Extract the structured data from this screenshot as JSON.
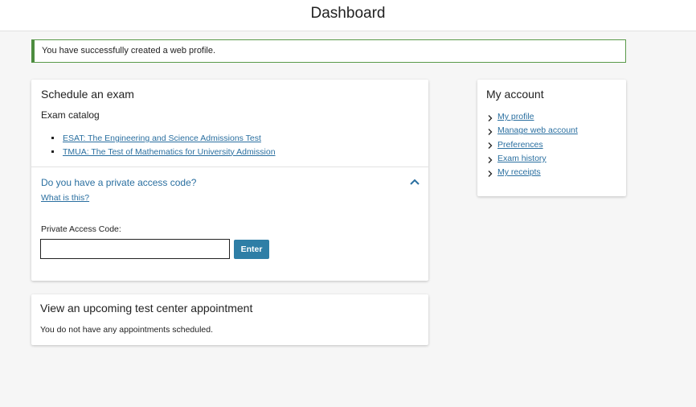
{
  "header": {
    "title": "Dashboard"
  },
  "alert": {
    "message": "You have successfully created a web profile."
  },
  "schedule": {
    "title": "Schedule an exam",
    "catalog_label": "Exam catalog",
    "exams": [
      "ESAT: The Engineering and Science Admissions Test",
      "TMUA: The Test of Mathematics for University Admission"
    ],
    "pac_question": "Do you have a private access code?",
    "what_is_this": "What is this?",
    "pac_label": "Private Access Code:",
    "pac_value": "",
    "enter_label": "Enter"
  },
  "account": {
    "title": "My account",
    "links": [
      "My profile",
      "Manage web account",
      "Preferences",
      "Exam history",
      "My receipts"
    ]
  },
  "appointment": {
    "title": "View an upcoming test center appointment",
    "message": "You do not have any appointments scheduled."
  },
  "icons": {
    "accordion": "chevron-up-icon",
    "list_marker": "chevron-right-icon"
  },
  "colors": {
    "link": "#2a6fa0",
    "button": "#2e7ea6",
    "alert_border": "#4d8c3f"
  }
}
